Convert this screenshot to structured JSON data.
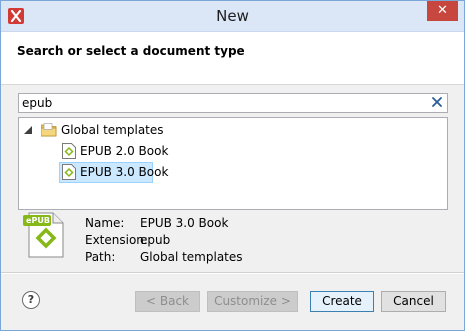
{
  "window": {
    "title": "New",
    "close_glyph": "✕"
  },
  "header": {
    "title": "Search or select a document type"
  },
  "search": {
    "value": "epub",
    "clear_icon": "clear-x-icon"
  },
  "tree": {
    "root": {
      "label": "Global templates",
      "expanded": true
    },
    "items": [
      {
        "label": "EPUB 2.0 Book",
        "selected": false
      },
      {
        "label": "EPUB 3.0 Book",
        "selected": true
      }
    ]
  },
  "details": {
    "icon_badge": "ePUB",
    "name_label": "Name:",
    "name_value": "EPUB 3.0 Book",
    "extension_label": "Extension:",
    "extension_value": "epub",
    "path_label": "Path:",
    "path_value": "Global templates"
  },
  "buttons": {
    "help": "?",
    "back": "< Back",
    "customize": "Customize >",
    "create": "Create",
    "cancel": "Cancel"
  },
  "colors": {
    "accent": "#c7463d",
    "selection": "#cce8ff",
    "epub_green": "#86b817"
  }
}
